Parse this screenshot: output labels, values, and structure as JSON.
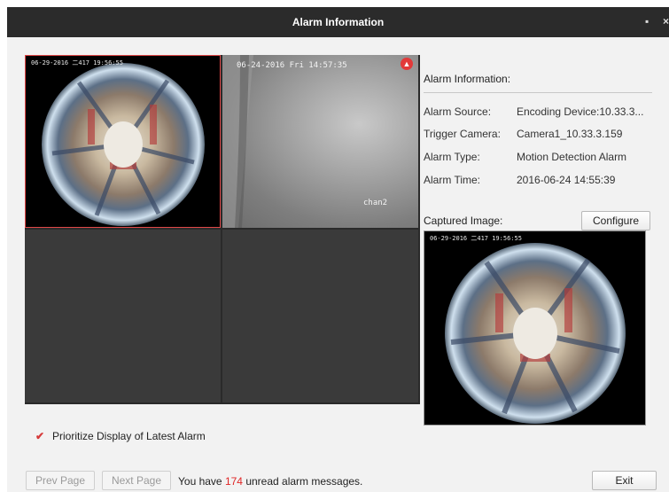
{
  "window": {
    "title": "Alarm Information",
    "restore_glyph": "▪",
    "close_glyph": "×"
  },
  "video_grid": {
    "tile1_timestamp": "06-29-2016 二417 19:56:55",
    "tile2_timestamp": "06-24-2016 Fri 14:57:35",
    "tile2_channel": "chan2"
  },
  "info": {
    "header": "Alarm Information:",
    "rows": [
      {
        "label": "Alarm Source:",
        "value": "Encoding Device:10.33.3..."
      },
      {
        "label": "Trigger Camera:",
        "value": "Camera1_10.33.3.159"
      },
      {
        "label": "Alarm Type:",
        "value": "Motion Detection Alarm"
      },
      {
        "label": "Alarm Time:",
        "value": "2016-06-24 14:55:39"
      }
    ],
    "captured_label": "Captured Image:",
    "configure_label": "Configure",
    "captured_timestamp": "06-29-2016 二417 19:56:55"
  },
  "options": {
    "prioritize_label": "Prioritize Display of Latest Alarm",
    "prioritize_checked": true
  },
  "footer": {
    "prev_label": "Prev Page",
    "next_label": "Next Page",
    "status_prefix": "You have ",
    "unread_count": "174",
    "status_suffix": " unread alarm messages.",
    "exit_label": "Exit"
  },
  "colors": {
    "titlebar": "#2b2b2b",
    "selected_tile_border": "#e04848",
    "unread_count": "#e02626",
    "alarm_badge": "#e23a3a"
  }
}
